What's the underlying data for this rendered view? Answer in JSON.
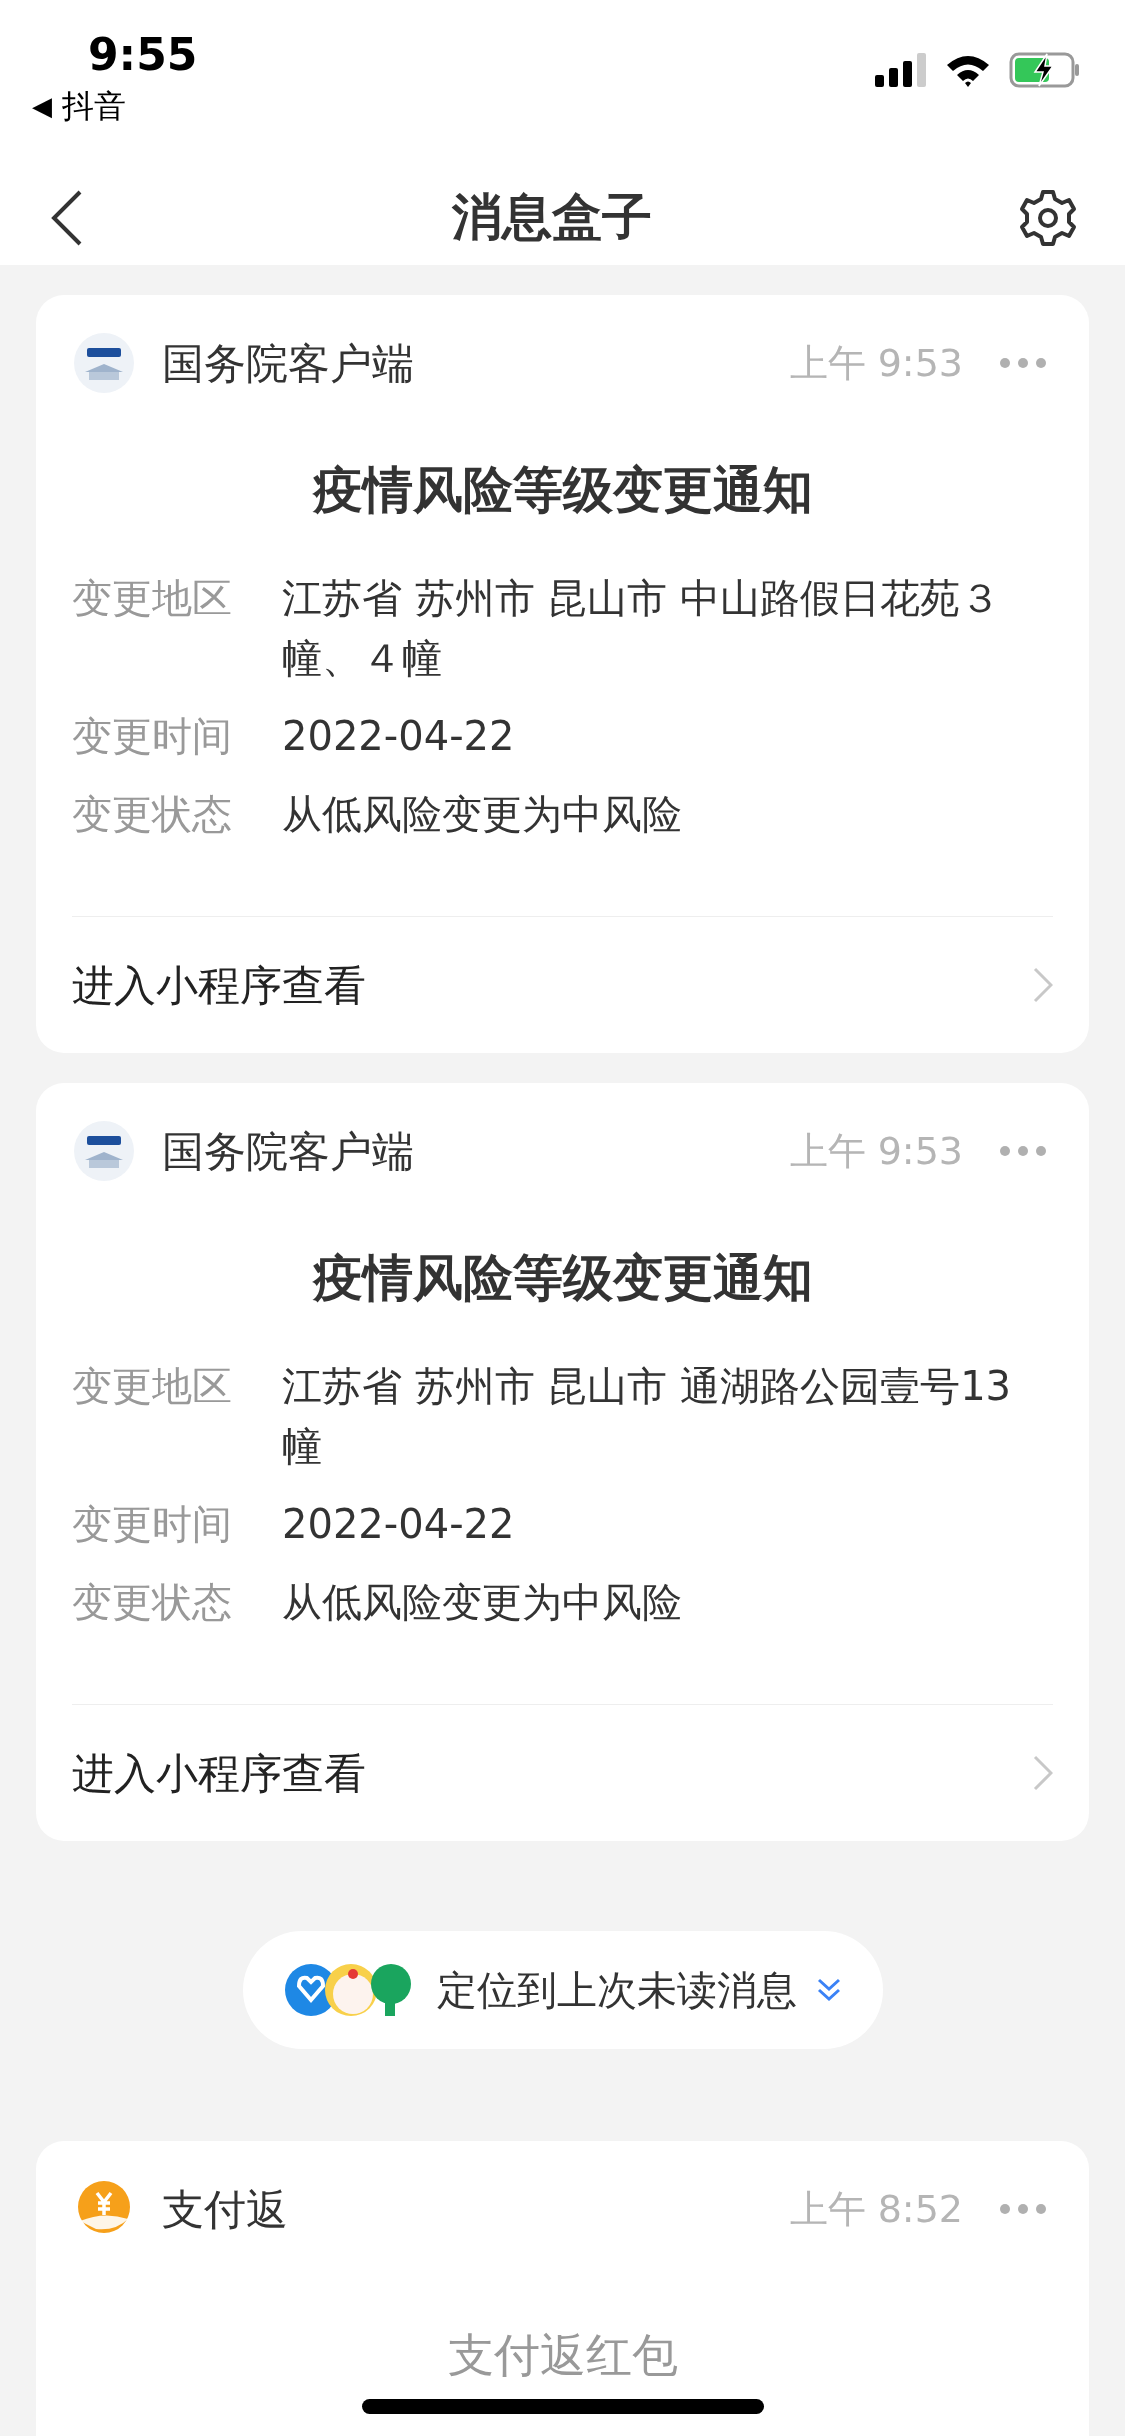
{
  "status_bar": {
    "time": "9:55",
    "back_arrow": "◀",
    "back_app": "抖音"
  },
  "header": {
    "title": "消息盒子"
  },
  "cards": [
    {
      "kind": "notice",
      "sender": "国务院客户端",
      "time": "上午 9:53",
      "title": "疫情风险等级变更通知",
      "fields": [
        {
          "label": "变更地区",
          "value": "江苏省 苏州市 昆山市 中山路假日花苑３幢、４幢"
        },
        {
          "label": "变更时间",
          "value": "2022-04-22"
        },
        {
          "label": "变更状态",
          "value": "从低风险变更为中风险"
        }
      ],
      "link": "进入小程序查看"
    },
    {
      "kind": "notice",
      "sender": "国务院客户端",
      "time": "上午 9:53",
      "title": "疫情风险等级变更通知",
      "fields": [
        {
          "label": "变更地区",
          "value": "江苏省 苏州市 昆山市 通湖路公园壹号13幢"
        },
        {
          "label": "变更时间",
          "value": "2022-04-22"
        },
        {
          "label": "变更状态",
          "value": "从低风险变更为中风险"
        }
      ],
      "link": "进入小程序查看"
    }
  ],
  "jump_pill": {
    "text": "定位到上次未读消息"
  },
  "bottom_card": {
    "kind": "pay",
    "sender": "支付返",
    "time": "上午 8:52",
    "title": "支付返红包"
  }
}
